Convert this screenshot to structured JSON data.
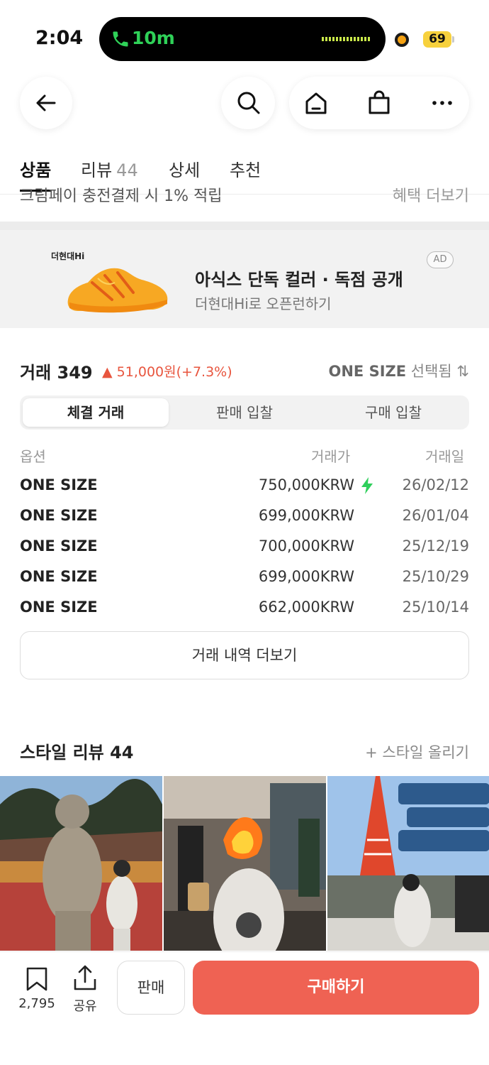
{
  "status_bar": {
    "time": "2:04",
    "call_duration": "10m",
    "battery": "69"
  },
  "tabs": [
    {
      "label": "상품"
    },
    {
      "label": "리뷰",
      "count": "44"
    },
    {
      "label": "상세"
    },
    {
      "label": "추천"
    }
  ],
  "clipped_row": {
    "left": "크림페이 충전결제 시 1% 적립",
    "right": "혜택 더보기"
  },
  "ad": {
    "brand": "더현대Hi",
    "title": "아식스 단독 컬러 · 독점 공개",
    "subtitle": "더현대Hi로 오픈런하기",
    "badge": "AD"
  },
  "trade": {
    "title": "거래 349",
    "change": "▲ 51,000원(+7.3%)",
    "size_value": "ONE SIZE",
    "size_suffix": "선택됨 ⇅",
    "segments": [
      "체결 거래",
      "판매 입찰",
      "구매 입찰"
    ],
    "columns": {
      "option": "옵션",
      "price": "거래가",
      "date": "거래일"
    },
    "rows": [
      {
        "option": "ONE SIZE",
        "price": "750,000KRW",
        "date": "26/02/12",
        "fast": true
      },
      {
        "option": "ONE SIZE",
        "price": "699,000KRW",
        "date": "26/01/04"
      },
      {
        "option": "ONE SIZE",
        "price": "700,000KRW",
        "date": "25/12/19"
      },
      {
        "option": "ONE SIZE",
        "price": "699,000KRW",
        "date": "25/10/29"
      },
      {
        "option": "ONE SIZE",
        "price": "662,000KRW",
        "date": "25/10/14"
      }
    ],
    "more_label": "거래 내역 더보기"
  },
  "style": {
    "title": "스타일 리뷰 44",
    "upload_label": "+ 스타일 올리기"
  },
  "bottom_bar": {
    "bookmark_count": "2,795",
    "share_label": "공유",
    "sell_label": "판매",
    "buy_label": "구매하기"
  },
  "colors": {
    "accent": "#ef6253",
    "rise": "#e8553e",
    "bolt": "#2fcf5b"
  }
}
